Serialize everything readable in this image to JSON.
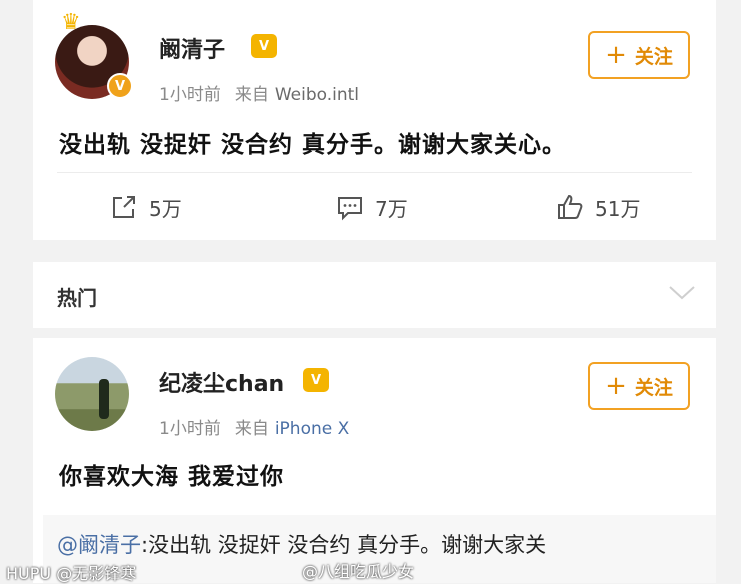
{
  "post": {
    "username": "阚清子",
    "vip_badge": "V",
    "verified_badge": "V",
    "time": "1小时前",
    "source_prefix": "来自",
    "source": "Weibo.intl",
    "follow_label": "关注",
    "content": "没出轨 没捉奸 没合约 真分手。谢谢大家关心。",
    "actions": {
      "share_count": "5万",
      "comment_count": "7万",
      "like_count": "51万"
    }
  },
  "hot": {
    "label": "热门"
  },
  "reply": {
    "username": "纪凌尘chan",
    "vip_badge": "V",
    "time": "1小时前",
    "source_prefix": "来自",
    "source": "iPhone X",
    "follow_label": "关注",
    "content": "你喜欢大海 我爱过你",
    "quote_mention": "@阚清子",
    "quote_text": ":没出轨 没捉奸 没合约 真分手。谢谢大家关"
  },
  "watermarks": {
    "left": "HUPU @无影锋寒",
    "right": "@八组吃瓜少女"
  },
  "colors": {
    "follow_accent": "#f2a123",
    "link": "#4a6fa5",
    "vip_gold": "#f4b400"
  }
}
